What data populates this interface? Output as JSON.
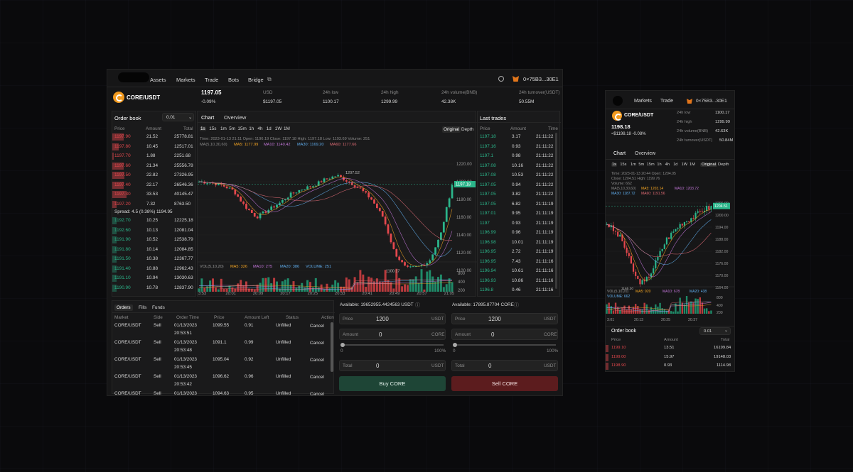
{
  "nav": {
    "items": [
      "Assets",
      "Markets",
      "Trade",
      "Bots",
      "Bridge"
    ],
    "wallet": "0×75B3...30E1"
  },
  "ticker": {
    "pair": "CORE/USDT",
    "price": "1197.05",
    "change": "-0.09%",
    "usd_label": "USD",
    "usd_value": "$1197.05",
    "low_label": "24h low",
    "low": "1100.17",
    "high_label": "24h high",
    "high": "1299.99",
    "vol_label": "24h volume(BNB)",
    "vol": "42.38K",
    "turnover_label": "24h turnover(USDT)",
    "turnover": "50.55M"
  },
  "orderbook": {
    "title": "Order book",
    "precision": "0.01",
    "cols": [
      "Price",
      "Amount",
      "Total"
    ],
    "asks": [
      [
        "1197.90",
        "21.52",
        "25778.81",
        0.8
      ],
      [
        "1197.80",
        "10.45",
        "12517.01",
        0.45
      ],
      [
        "1197.70",
        "1.88",
        "2251.68",
        0.1
      ],
      [
        "1197.60",
        "21.34",
        "25556.78",
        0.8
      ],
      [
        "1197.50",
        "22.82",
        "27326.95",
        0.85
      ],
      [
        "1197.40",
        "22.17",
        "26546.36",
        0.82
      ],
      [
        "1197.30",
        "33.53",
        "40145.47",
        1.0
      ],
      [
        "1197.20",
        "7.32",
        "8763.50",
        0.3
      ]
    ],
    "spread": "Spread: 4.5 (0.38%) 1194.95",
    "bids": [
      [
        "1192.70",
        "10.25",
        "12225.18",
        0.3
      ],
      [
        "1192.60",
        "10.13",
        "12081.04",
        0.3
      ],
      [
        "1191.90",
        "10.52",
        "12538.79",
        0.3
      ],
      [
        "1191.80",
        "10.14",
        "12084.85",
        0.3
      ],
      [
        "1191.50",
        "10.38",
        "12367.77",
        0.3
      ],
      [
        "1191.40",
        "10.88",
        "12962.43",
        0.32
      ],
      [
        "1191.10",
        "10.94",
        "13030.63",
        0.32
      ],
      [
        "1190.90",
        "10.78",
        "12837.90",
        0.32
      ]
    ]
  },
  "chart": {
    "tabs": [
      "Chart",
      "Overview"
    ],
    "intervals": [
      "1s",
      "15s",
      "1m",
      "5m",
      "15m",
      "1h",
      "4h",
      "1d",
      "1W",
      "1M"
    ],
    "views": [
      "Original",
      "Depth"
    ],
    "info": "Time: 2023-01-13 21:11   Open: 1196.19   Close: 1197.18   High: 1197.18   Low: 1193.69   Volume: 251",
    "ma_label": "MA(5,10,30,60)",
    "ma5": "MA5: 1177.99",
    "ma10": "MA10: 1140.42",
    "ma30": "MA30: 1169.20",
    "ma60": "MA60: 1177.66",
    "yticks": [
      "1220.00",
      "1200.00",
      "1180.00",
      "1160.00",
      "1140.00",
      "1120.00",
      "1100.00"
    ],
    "last": "1197.18",
    "hi_mark": "1207.52",
    "lo_mark": "1100.17",
    "vol_label": "VOL(5,10,20)",
    "vma5": "MA5: 326",
    "vma10": "MA10: 275",
    "vma20": "MA20: 386",
    "volume": "VOLUME: 251",
    "vticks": [
      "800",
      "400",
      "200"
    ],
    "xticks": [
      "3:53",
      "20:01",
      "20:09",
      "20:17",
      "20:25",
      "20:33",
      "20:41",
      "20:49",
      "20:57",
      "21:05"
    ]
  },
  "trades": {
    "title": "Last trades",
    "cols": [
      "Price",
      "Amount",
      "Time"
    ],
    "rows": [
      [
        "1197.18",
        "3.17",
        "21:11:22"
      ],
      [
        "1197.16",
        "0.93",
        "21:11:22"
      ],
      [
        "1197.1",
        "0.98",
        "21:11:22"
      ],
      [
        "1197.08",
        "10.16",
        "21:11:22"
      ],
      [
        "1197.08",
        "10.53",
        "21:11:22"
      ],
      [
        "1197.05",
        "0.94",
        "21:11:22"
      ],
      [
        "1197.05",
        "3.82",
        "21:11:22"
      ],
      [
        "1197.05",
        "6.82",
        "21:11:19"
      ],
      [
        "1197.01",
        "9.95",
        "21:11:19"
      ],
      [
        "1197",
        "0.93",
        "21:11:19"
      ],
      [
        "1196.99",
        "0.96",
        "21:11:19"
      ],
      [
        "1196.98",
        "10.01",
        "21:11:19"
      ],
      [
        "1196.95",
        "2.72",
        "21:11:19"
      ],
      [
        "1196.95",
        "7.43",
        "21:11:16"
      ],
      [
        "1196.94",
        "10.61",
        "21:11:16"
      ],
      [
        "1196.93",
        "10.86",
        "21:11:16"
      ],
      [
        "1196.8",
        "0.46",
        "21:11:16"
      ]
    ]
  },
  "orders": {
    "tabs": [
      "Orders",
      "Fills",
      "Funds"
    ],
    "cols": [
      "Market",
      "Side",
      "Order Time",
      "Price",
      "Amount Left",
      "Status",
      "Action"
    ],
    "rows": [
      [
        "CORE/USDT",
        "Sell",
        "01/13/2023",
        "20:53:51",
        "1099.55",
        "0.91",
        "Unfilled",
        "Cancel"
      ],
      [
        "CORE/USDT",
        "Sell",
        "01/13/2023",
        "20:53:48",
        "1091.1",
        "0.99",
        "Unfilled",
        "Cancel"
      ],
      [
        "CORE/USDT",
        "Sell",
        "01/13/2023",
        "20:53:45",
        "1095.04",
        "0.92",
        "Unfilled",
        "Cancel"
      ],
      [
        "CORE/USDT",
        "Sell",
        "01/13/2023",
        "20:53:42",
        "1096.62",
        "0.96",
        "Unfilled",
        "Cancel"
      ],
      [
        "CORE/USDT",
        "Sell",
        "01/13/2023",
        "",
        "1094.63",
        "0.95",
        "Unfilled",
        "Cancel"
      ]
    ]
  },
  "buy": {
    "available": "Available: 19652955.4424563 USDT",
    "price_label": "Price",
    "price": "1200",
    "price_unit": "USDT",
    "amount_label": "Amount",
    "amount": "0",
    "amount_unit": "CORE",
    "pct0": "0",
    "pct100": "100%",
    "total_label": "Total",
    "total": "0",
    "total_unit": "USDT",
    "button": "Buy CORE"
  },
  "sell": {
    "available": "Available: 17895.87704 CORE",
    "price_label": "Price",
    "price": "1200",
    "price_unit": "USDT",
    "amount_label": "Amount",
    "amount": "0",
    "amount_unit": "CORE",
    "pct0": "0",
    "pct100": "100%",
    "total_label": "Total",
    "total": "0",
    "total_unit": "USDT",
    "button": "Sell CORE"
  },
  "mobile": {
    "nav": [
      "Markets",
      "Trade"
    ],
    "wallet": "0×75B3...30E1",
    "pair": "CORE/USDT",
    "price": "1198.18",
    "sub": "≈$1198.18  -0.08%",
    "stats": [
      [
        "24h low",
        "1100.17"
      ],
      [
        "24h high",
        "1299.99"
      ],
      [
        "24h volume(BNB)",
        "42.63K"
      ],
      [
        "24h turnover(USDT)",
        "50.84M"
      ]
    ],
    "tabs": [
      "Chart",
      "Overview"
    ],
    "intervals": [
      "1s",
      "15s",
      "1m",
      "5m",
      "15m",
      "1h",
      "4h",
      "1d",
      "1W",
      "1M"
    ],
    "views": [
      "Original",
      "Depth"
    ],
    "info1": "Time: 2023-01-13 20:44   Open: 1204.05",
    "info2": "Close: 1204.51   High: 1199.76",
    "info3": "Volume: 662",
    "ma_label": "MA(5,10,30,60)",
    "ma5": "MA5: 1203.14",
    "ma10": "MA10: 1203.72",
    "ma30": "MA30: 1187.72",
    "ma60": "MA60: 1191.56",
    "yticks": [
      "1206.00",
      "1200.00",
      "1194.00",
      "1188.00",
      "1182.00",
      "1176.00",
      "1170.00",
      "1164.00"
    ],
    "last": "1204.51",
    "lo_mark": "1165.30",
    "vol_label": "VOL(5,10,20)",
    "vma5": "MA5: 920",
    "vma10": "MA10: 678",
    "vma20": "MA20: 438",
    "volume": "VOLUME: 662",
    "vticks": [
      "800",
      "400",
      "200"
    ],
    "xticks": [
      "3:01",
      "20:13",
      "20:25",
      "20:37"
    ],
    "ob_title": "Order book",
    "ob_precision": "0.01",
    "ob_cols": [
      "Price",
      "Amount",
      "Total"
    ],
    "ob_rows": [
      [
        "1199.10",
        "13.51",
        "16199.84"
      ],
      [
        "1199.00",
        "15.97",
        "19148.03"
      ],
      [
        "1198.90",
        "0.93",
        "1114.98"
      ]
    ]
  }
}
